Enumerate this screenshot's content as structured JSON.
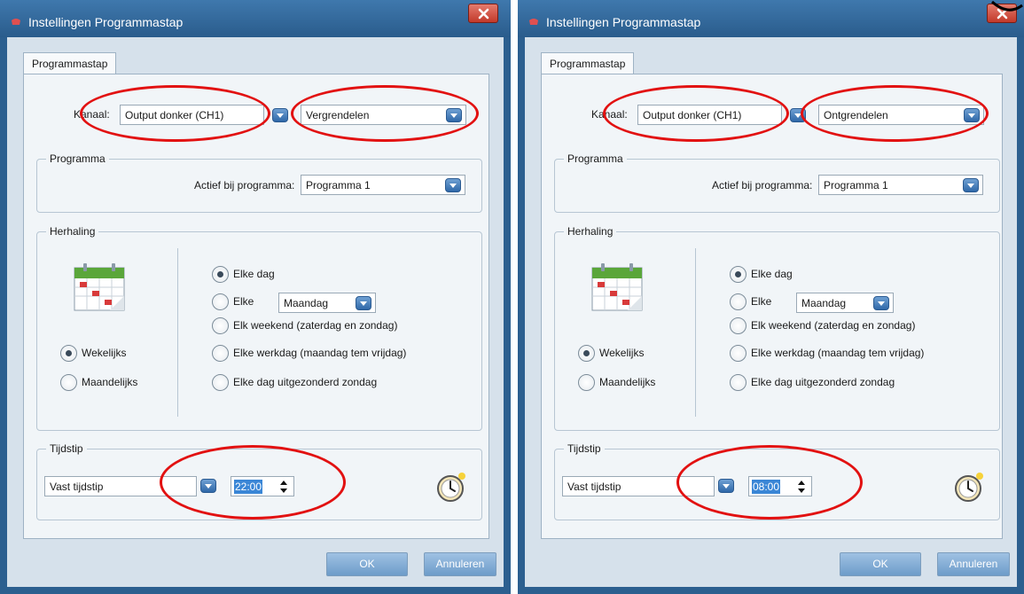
{
  "colors": {
    "accent_red": "#e21111",
    "titlebar_blue": "#2c5f8f",
    "panel_bg": "#f1f5f8",
    "button_blue": "#6d9cc9"
  },
  "dialogs": [
    {
      "title": "Instellingen Programmastap",
      "tab_label": "Programmastap",
      "kanaal_label": "Kanaal:",
      "kanaal_value": "Output donker (CH1)",
      "actie_value": "Vergrendelen",
      "programma_legend": "Programma",
      "actief_label": "Actief bij programma:",
      "programma_value": "Programma 1",
      "herhaling_legend": "Herhaling",
      "period_options": [
        {
          "label": "Wekelijks",
          "checked": true
        },
        {
          "label": "Maandelijks",
          "checked": false
        }
      ],
      "day_options": [
        {
          "label": "Elke dag",
          "checked": true
        },
        {
          "label": "Elke",
          "checked": false
        },
        {
          "label": "Elk weekend (zaterdag en zondag)",
          "checked": false
        },
        {
          "label": "Elke werkdag (maandag tem vrijdag)",
          "checked": false
        },
        {
          "label": "Elke dag uitgezonderd zondag",
          "checked": false
        }
      ],
      "weekday_value": "Maandag",
      "tijdstip_legend": "Tijdstip",
      "tijdstip_type": "Vast tijdstip",
      "time_value": "22:00",
      "ok_label": "OK",
      "cancel_label": "Annuleren",
      "icons": [
        "calendar-icon",
        "clock-icon",
        "close-icon"
      ]
    },
    {
      "title": "Instellingen Programmastap",
      "tab_label": "Programmastap",
      "kanaal_label": "Kanaal:",
      "kanaal_value": "Output donker (CH1)",
      "actie_value": "Ontgrendelen",
      "programma_legend": "Programma",
      "actief_label": "Actief bij programma:",
      "programma_value": "Programma 1",
      "herhaling_legend": "Herhaling",
      "period_options": [
        {
          "label": "Wekelijks",
          "checked": true
        },
        {
          "label": "Maandelijks",
          "checked": false
        }
      ],
      "day_options": [
        {
          "label": "Elke dag",
          "checked": true
        },
        {
          "label": "Elke",
          "checked": false
        },
        {
          "label": "Elk weekend (zaterdag en zondag)",
          "checked": false
        },
        {
          "label": "Elke werkdag (maandag tem vrijdag)",
          "checked": false
        },
        {
          "label": "Elke dag uitgezonderd zondag",
          "checked": false
        }
      ],
      "weekday_value": "Maandag",
      "tijdstip_legend": "Tijdstip",
      "tijdstip_type": "Vast tijdstip",
      "time_value": "08:00",
      "ok_label": "OK",
      "cancel_label": "Annuleren",
      "icons": [
        "calendar-icon",
        "clock-icon",
        "close-icon"
      ]
    }
  ]
}
